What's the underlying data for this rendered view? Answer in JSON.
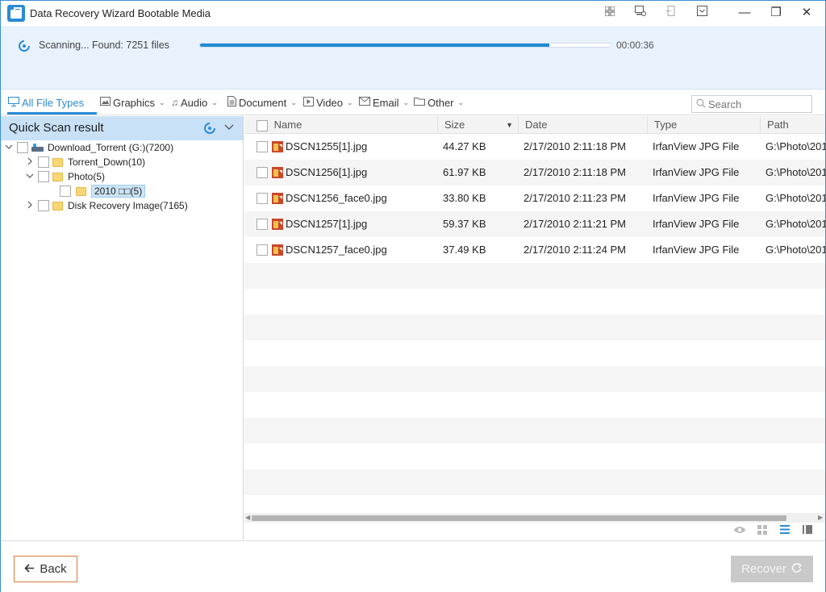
{
  "window": {
    "title": "Data Recovery Wizard Bootable Media",
    "toolbar_icons": [
      "windows-icon",
      "device-settings-icon",
      "export-icon",
      "dropdown-box-icon"
    ],
    "window_controls": {
      "minimize": "—",
      "maximize": "❐",
      "close": "✕"
    }
  },
  "scan": {
    "status": "Scanning... Found: 7251 files",
    "progress_percent": 85,
    "elapsed": "00:00:36"
  },
  "filters": {
    "items": [
      {
        "label": "All File Types",
        "icon": "monitor-icon"
      },
      {
        "label": "Graphics",
        "icon": "image-icon"
      },
      {
        "label": "Audio",
        "icon": "music-note-icon"
      },
      {
        "label": "Document",
        "icon": "document-icon"
      },
      {
        "label": "Video",
        "icon": "video-icon"
      },
      {
        "label": "Email",
        "icon": "email-icon"
      },
      {
        "label": "Other",
        "icon": "folder-icon"
      }
    ],
    "active_index": 0,
    "search_placeholder": "Search"
  },
  "tree": {
    "title": "Quick Scan result",
    "nodes": [
      {
        "label": "Download_Torrent (G:)(7200)",
        "type": "drive",
        "expander": "collapse"
      },
      {
        "label": "Torrent_Down(10)",
        "type": "folder",
        "expander": "expand"
      },
      {
        "label": "Photo(5)",
        "type": "folder",
        "expander": "collapse"
      },
      {
        "label": "2010 □□(5)",
        "type": "folder",
        "expander": "none",
        "selected": true
      },
      {
        "label": "Disk Recovery Image(7165)",
        "type": "folder",
        "expander": "expand"
      }
    ]
  },
  "table": {
    "columns": [
      "Name",
      "Size",
      "Date",
      "Type",
      "Path"
    ],
    "sort_column": "Size",
    "rows": [
      {
        "name": "DSCN1255[1].jpg",
        "size": "44.27 KB",
        "date": "2/17/2010 2:11:18 PM",
        "type": "IrfanView JPG File",
        "path": "G:\\Photo\\201"
      },
      {
        "name": "DSCN1256[1].jpg",
        "size": "61.97 KB",
        "date": "2/17/2010 2:11:18 PM",
        "type": "IrfanView JPG File",
        "path": "G:\\Photo\\201"
      },
      {
        "name": "DSCN1256_face0.jpg",
        "size": "33.80 KB",
        "date": "2/17/2010 2:11:23 PM",
        "type": "IrfanView JPG File",
        "path": "G:\\Photo\\201"
      },
      {
        "name": "DSCN1257[1].jpg",
        "size": "59.37 KB",
        "date": "2/17/2010 2:11:21 PM",
        "type": "IrfanView JPG File",
        "path": "G:\\Photo\\201"
      },
      {
        "name": "DSCN1257_face0.jpg",
        "size": "37.49 KB",
        "date": "2/17/2010 2:11:24 PM",
        "type": "IrfanView JPG File",
        "path": "G:\\Photo\\201"
      }
    ]
  },
  "view_modes": [
    "preview-eye-icon",
    "thumbnail-grid-icon",
    "list-view-icon",
    "detail-view-icon"
  ],
  "footer": {
    "back_label": "Back",
    "recover_label": "Recover"
  },
  "colors": {
    "accent": "#2a8bd6",
    "scan_bg": "#e8f2fc",
    "tree_header_bg": "#c8e1f6",
    "back_border": "#d47a3b",
    "recover_disabled": "#c9c9c9"
  }
}
